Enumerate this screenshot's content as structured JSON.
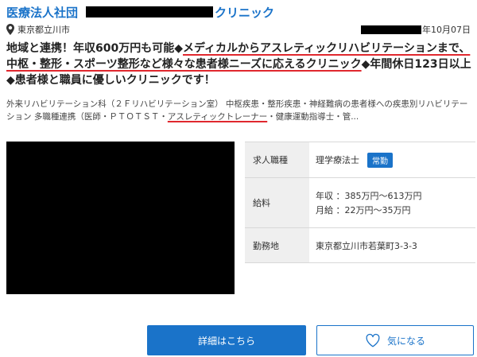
{
  "header": {
    "org_prefix": "医療法人社団",
    "org_suffix": "クリニック"
  },
  "location": {
    "text": "東京都立川市"
  },
  "date": {
    "text": "年10月07日"
  },
  "headline": {
    "part1": "地域と連携！年収600万円も可能◆",
    "part2_underlined": "メディカルからアスレティックリハビリテーションまで、中枢・整形・スポーツ整形など様々な患者様ニーズに応えるクリニック",
    "part3": "◆年間休日123日以上◆患者様と職員に優しいクリニックです！"
  },
  "description": {
    "part1": "外来リハビリテーション科（２Ｆリハビリテーション室） 中枢疾患・整形疾患・神経難病の患者様への疾患別リハビリテーション 多職種連携（医師・ＰＴＯＴＳＴ・",
    "part2_underlined": "アスレティックトレーナー",
    "part3": "・健康運動指導士・管..."
  },
  "info": {
    "job_type_label": "求人職種",
    "job_type_value": "理学療法士",
    "employment_badge": "常勤",
    "salary_label": "給料",
    "salary_annual": "年収 ：385万円～613万円",
    "salary_monthly": "月給 ：22万円～35万円",
    "location_label": "勤務地",
    "location_value": "東京都立川市若葉町3-3-3"
  },
  "buttons": {
    "detail_label": "詳細はこちら",
    "favorite_label": "気になる"
  },
  "colors": {
    "brand_blue": "#1a73c9",
    "underline_red": "#e0282e",
    "label_bg": "#efefef"
  }
}
